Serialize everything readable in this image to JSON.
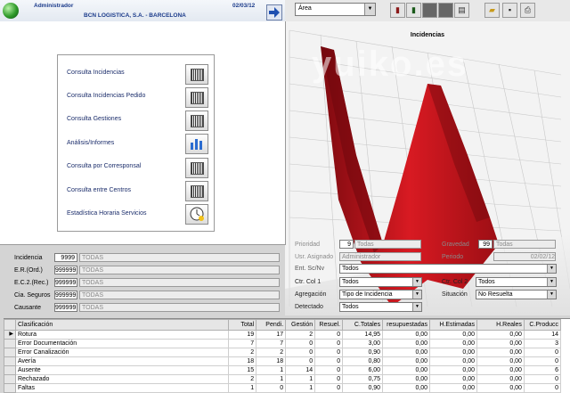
{
  "header": {
    "user": "Administrador",
    "company": "BCN LOGISTICA, S.A. - BARCELONA",
    "date": "02/03/12",
    "area_select": "Área"
  },
  "menu": {
    "items": [
      {
        "label": "Consulta Incidencias",
        "icon": "barcode-icon"
      },
      {
        "label": "Consulta Incidencias Pedido",
        "icon": "barcode-icon"
      },
      {
        "label": "Consulta Gestiones",
        "icon": "barcode-icon"
      },
      {
        "label": "Análisis/Informes",
        "icon": "bar-chart-icon"
      },
      {
        "label": "Consulta por Corresponsal",
        "icon": "barcode-icon"
      },
      {
        "label": "Consulta entre Centros",
        "icon": "barcode-icon"
      },
      {
        "label": "Estadística Horaria Servicios",
        "icon": "clock-icon"
      }
    ]
  },
  "chart": {
    "title": "Incidencias",
    "watermark": "yuiko.es"
  },
  "filters_left": [
    {
      "label": "Incidencia",
      "code": "9999",
      "desc": "TODAS"
    },
    {
      "label": "E.R.(Ord.)",
      "code": "999999",
      "desc": "TODAS"
    },
    {
      "label": "E.C.2.(Rec.)",
      "code": "999999",
      "desc": "TODAS"
    },
    {
      "label": "Cia. Seguros",
      "code": "999999",
      "desc": "TODAS"
    },
    {
      "label": "Causante",
      "code": "999999",
      "desc": "TODAS"
    }
  ],
  "filters_right": {
    "prioridad_label": "Prioridad",
    "prioridad_code": "9",
    "prioridad_desc": "Todas",
    "gravedad_label": "Gravedad",
    "gravedad_code": "99",
    "gravedad_desc": "Todas",
    "usuario_label": "Usr. Asignado",
    "usuario_value": "Administrador",
    "periodo_label": "Periodo",
    "periodo_value": "02/02/12",
    "ent_label": "Ent. Sc/Nv",
    "ent_value": "Todos",
    "ctrcol1_label": "Ctr. Col 1",
    "ctrcol1_value": "Todos",
    "ctrcol2_label": "Ctr. Col 2",
    "ctrcol2_value": "Todos",
    "agregacion_label": "Agregación",
    "agregacion_value": "Tipo de Incidencia",
    "situacion_label": "Situación",
    "situacion_value": "No Resuelta",
    "detectado_label": "Detectado",
    "detectado_value": "Todos"
  },
  "table": {
    "columns": [
      "Clasificación",
      "Total",
      "Pendi.",
      "Gestión",
      "Resuel.",
      "C.Totales",
      "resupuestadas",
      "H.Estimadas",
      "H.Reales",
      "C.Producc"
    ],
    "rows": [
      [
        "Rotura",
        "19",
        "17",
        "2",
        "0",
        "14,95",
        "0,00",
        "0,00",
        "0,00",
        "14"
      ],
      [
        "Error Documentación",
        "7",
        "7",
        "0",
        "0",
        "3,00",
        "0,00",
        "0,00",
        "0,00",
        "3"
      ],
      [
        "Error Canalización",
        "2",
        "2",
        "0",
        "0",
        "0,90",
        "0,00",
        "0,00",
        "0,00",
        "0"
      ],
      [
        "Avería",
        "18",
        "18",
        "0",
        "0",
        "0,80",
        "0,00",
        "0,00",
        "0,00",
        "0"
      ],
      [
        "Ausente",
        "15",
        "1",
        "14",
        "0",
        "6,00",
        "0,00",
        "0,00",
        "0,00",
        "6"
      ],
      [
        "Rechazado",
        "2",
        "1",
        "1",
        "0",
        "0,75",
        "0,00",
        "0,00",
        "0,00",
        "0"
      ],
      [
        "Faltas",
        "1",
        "0",
        "1",
        "0",
        "0,90",
        "0,00",
        "0,00",
        "0,00",
        "0"
      ]
    ]
  },
  "colors": {
    "chart_red": "#c4121b",
    "header_blue": "#1a3a8a",
    "menu_text": "#1b2d6b"
  }
}
